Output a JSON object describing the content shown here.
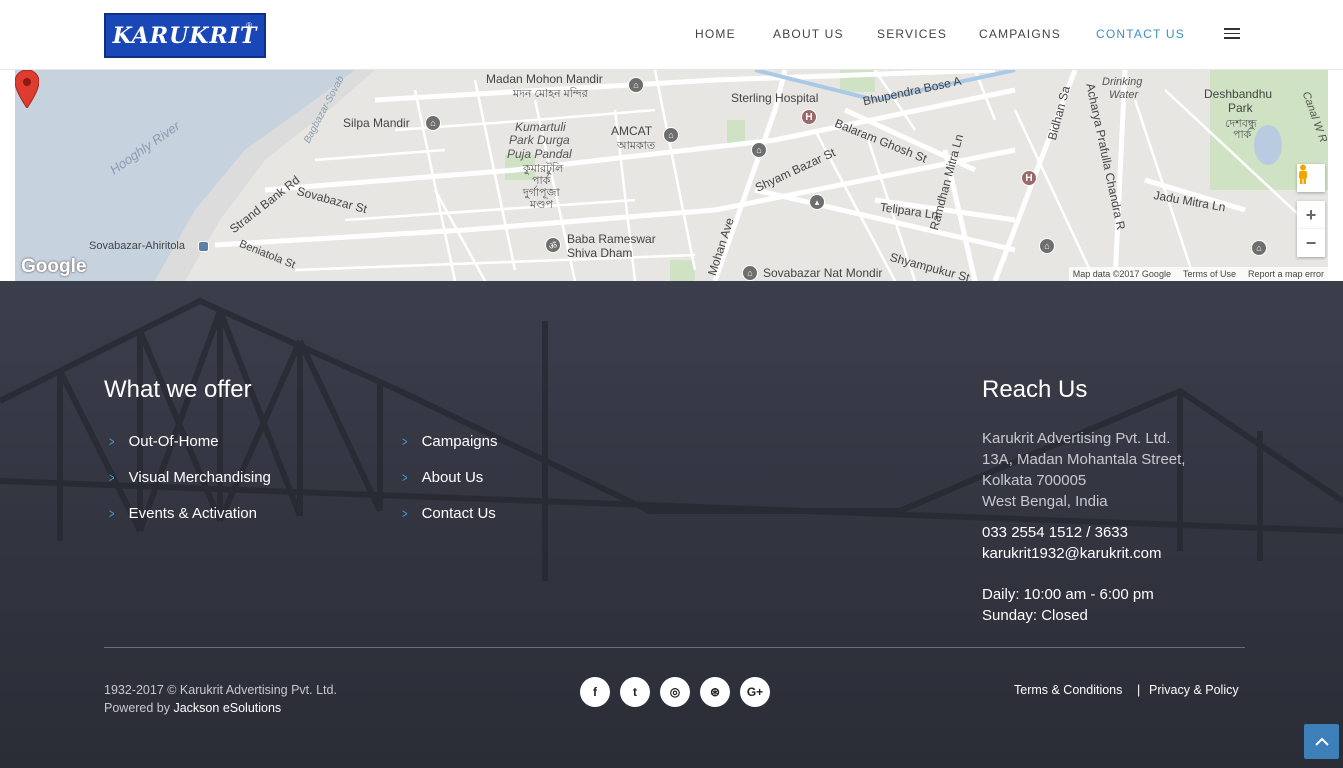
{
  "header": {
    "logo_text": "KARUKRIT",
    "logo_mark": "®",
    "nav": [
      {
        "label": "HOME",
        "active": false
      },
      {
        "label": "ABOUT US",
        "active": false
      },
      {
        "label": "SERVICES",
        "active": false
      },
      {
        "label": "CAMPAIGNS",
        "active": false
      },
      {
        "label": "CONTACT US",
        "active": true
      }
    ],
    "menu_icon": "hamburger-icon",
    "accent_color": "#3d8fc4"
  },
  "map": {
    "labels": {
      "madan_mohon": "Madan Mohon Mandir",
      "madan_mohon_bn": "মদন মোহন মন্দির",
      "silpa": "Silpa Mandir",
      "kumartuli1": "Kumartuli",
      "kumartuli2": "Park Durga",
      "kumartuli3": "Puja Pandal",
      "kumartuli_bn1": "কুমারটুলি",
      "kumartuli_bn2": "পার্ক",
      "kumartuli_bn3": "দুর্গাপূজা",
      "kumartuli_bn4": "মণ্ডপ",
      "amcat": "AMCAT",
      "amcat_bn": "আমকাত",
      "sterling": "Sterling Hospital",
      "bhupendra": "Bhupendra Bose A",
      "balaram": "Balaram Ghosh St",
      "shyam_bazar": "Shyam Bazar St",
      "telipara": "Telipara Ln",
      "ramdhan": "Ramdhan Mitra Ln",
      "bidhan": "Bidhan Sa",
      "acharya": "Acharya Prafulla Chandra R",
      "jadu": "Jadu Mitra Ln",
      "drinking1": "Drinking",
      "drinking2": "Water",
      "deshbandhu1": "Deshbandhu",
      "deshbandhu2": "Park",
      "deshbandhu_bn1": "দেশবন্ধু",
      "deshbandhu_bn2": "পার্ক",
      "canal": "Canal W R",
      "hooghly": "Hooghly River",
      "bagbazar": "Bagbazar-Sovab",
      "strand": "Strand Bank Rd",
      "sovabazar_st": "Sovabazar St",
      "sovabazar_ahiritola": "Sovabazar-Ahiritola",
      "beniatola": "Beniatola St",
      "baba1": "Baba Rameswar",
      "baba2": "Shiva Dham",
      "mohan_ave": "Mohan Ave",
      "sovabazar_nat": "Sovabazar Nat Mondir",
      "shyampukur": "Shyampukur St"
    },
    "google": "Google",
    "map_data": "Map data ©2017 Google",
    "terms": "Terms of Use",
    "report": "Report a map error",
    "zoom_in": "+",
    "zoom_out": "−"
  },
  "footer": {
    "offer_title": "What we offer",
    "offer_col1": [
      "Out-Of-Home",
      "Visual Merchandising",
      "Events & Activation"
    ],
    "offer_col2": [
      "Campaigns",
      "About Us",
      "Contact Us"
    ],
    "reach_title": "Reach Us",
    "address": [
      "Karukrit Advertising Pvt. Ltd.",
      "13A, Madan Mohantala Street,",
      "Kolkata 700005",
      "West Bengal, India"
    ],
    "phone": "033 2554 1512 / 3633",
    "email": "karukrit1932@karukrit.com",
    "hours": [
      "Daily: 10:00 am - 6:00 pm",
      "Sunday: Closed"
    ],
    "copyright": "1932-2017 © Karukrit Advertising Pvt. Ltd.",
    "powered_prefix": "Powered by ",
    "powered_by": "Jackson eSolutions",
    "social": [
      {
        "icon": "facebook-icon",
        "glyph": "f"
      },
      {
        "icon": "twitter-icon",
        "glyph": "t"
      },
      {
        "icon": "instagram-icon",
        "glyph": "◎"
      },
      {
        "icon": "dribbble-icon",
        "glyph": "⊛"
      },
      {
        "icon": "google-plus-icon",
        "glyph": "G+"
      }
    ],
    "terms": "Terms & Conditions",
    "separator": "|",
    "privacy": "Privacy & Policy",
    "scroll_top_icon": "chevron-up-icon"
  }
}
